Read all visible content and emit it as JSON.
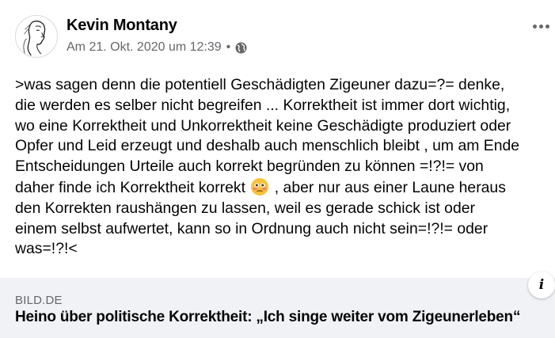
{
  "post": {
    "author": "Kevin Montany",
    "timestamp": "Am 21. Okt. 2020 um 12:39",
    "separator": "•",
    "privacy_icon": "globe-icon",
    "more_icon": "more-options-icon",
    "text_part1": ">was sagen denn die potentiell Geschädigten Zigeuner dazu=?= denke,\ndie werden es selber nicht begreifen ... Korrektheit ist immer dort wichtig,\nwo eine Korrektheit und Unkorrektheit keine Geschädigte produziert oder\nOpfer und Leid erzeugt und deshalb auch menschlich bleibt , um am Ende\nEntscheidungen Urteile auch korrekt begründen zu können =!?!= von\ndaher finde ich Korrektheit korrekt ",
    "emoji": "flushed-face-emoji",
    "text_part2": " , aber nur aus einer Laune heraus\nden Korrekten raushängen zu lassen, weil es gerade schick ist oder\neinem selbst aufwertet, kann so in Ordnung auch nicht sein=!?!= oder\nwas=!?!<"
  },
  "link_preview": {
    "source": "BILD.DE",
    "headline": "Heino über politische Korrektheit: „Ich singe weiter vom Zigeunerleben“",
    "info_label": "i",
    "background_color": "#f0f2f5"
  },
  "colors": {
    "text_primary": "#050505",
    "text_secondary": "#65676b"
  }
}
